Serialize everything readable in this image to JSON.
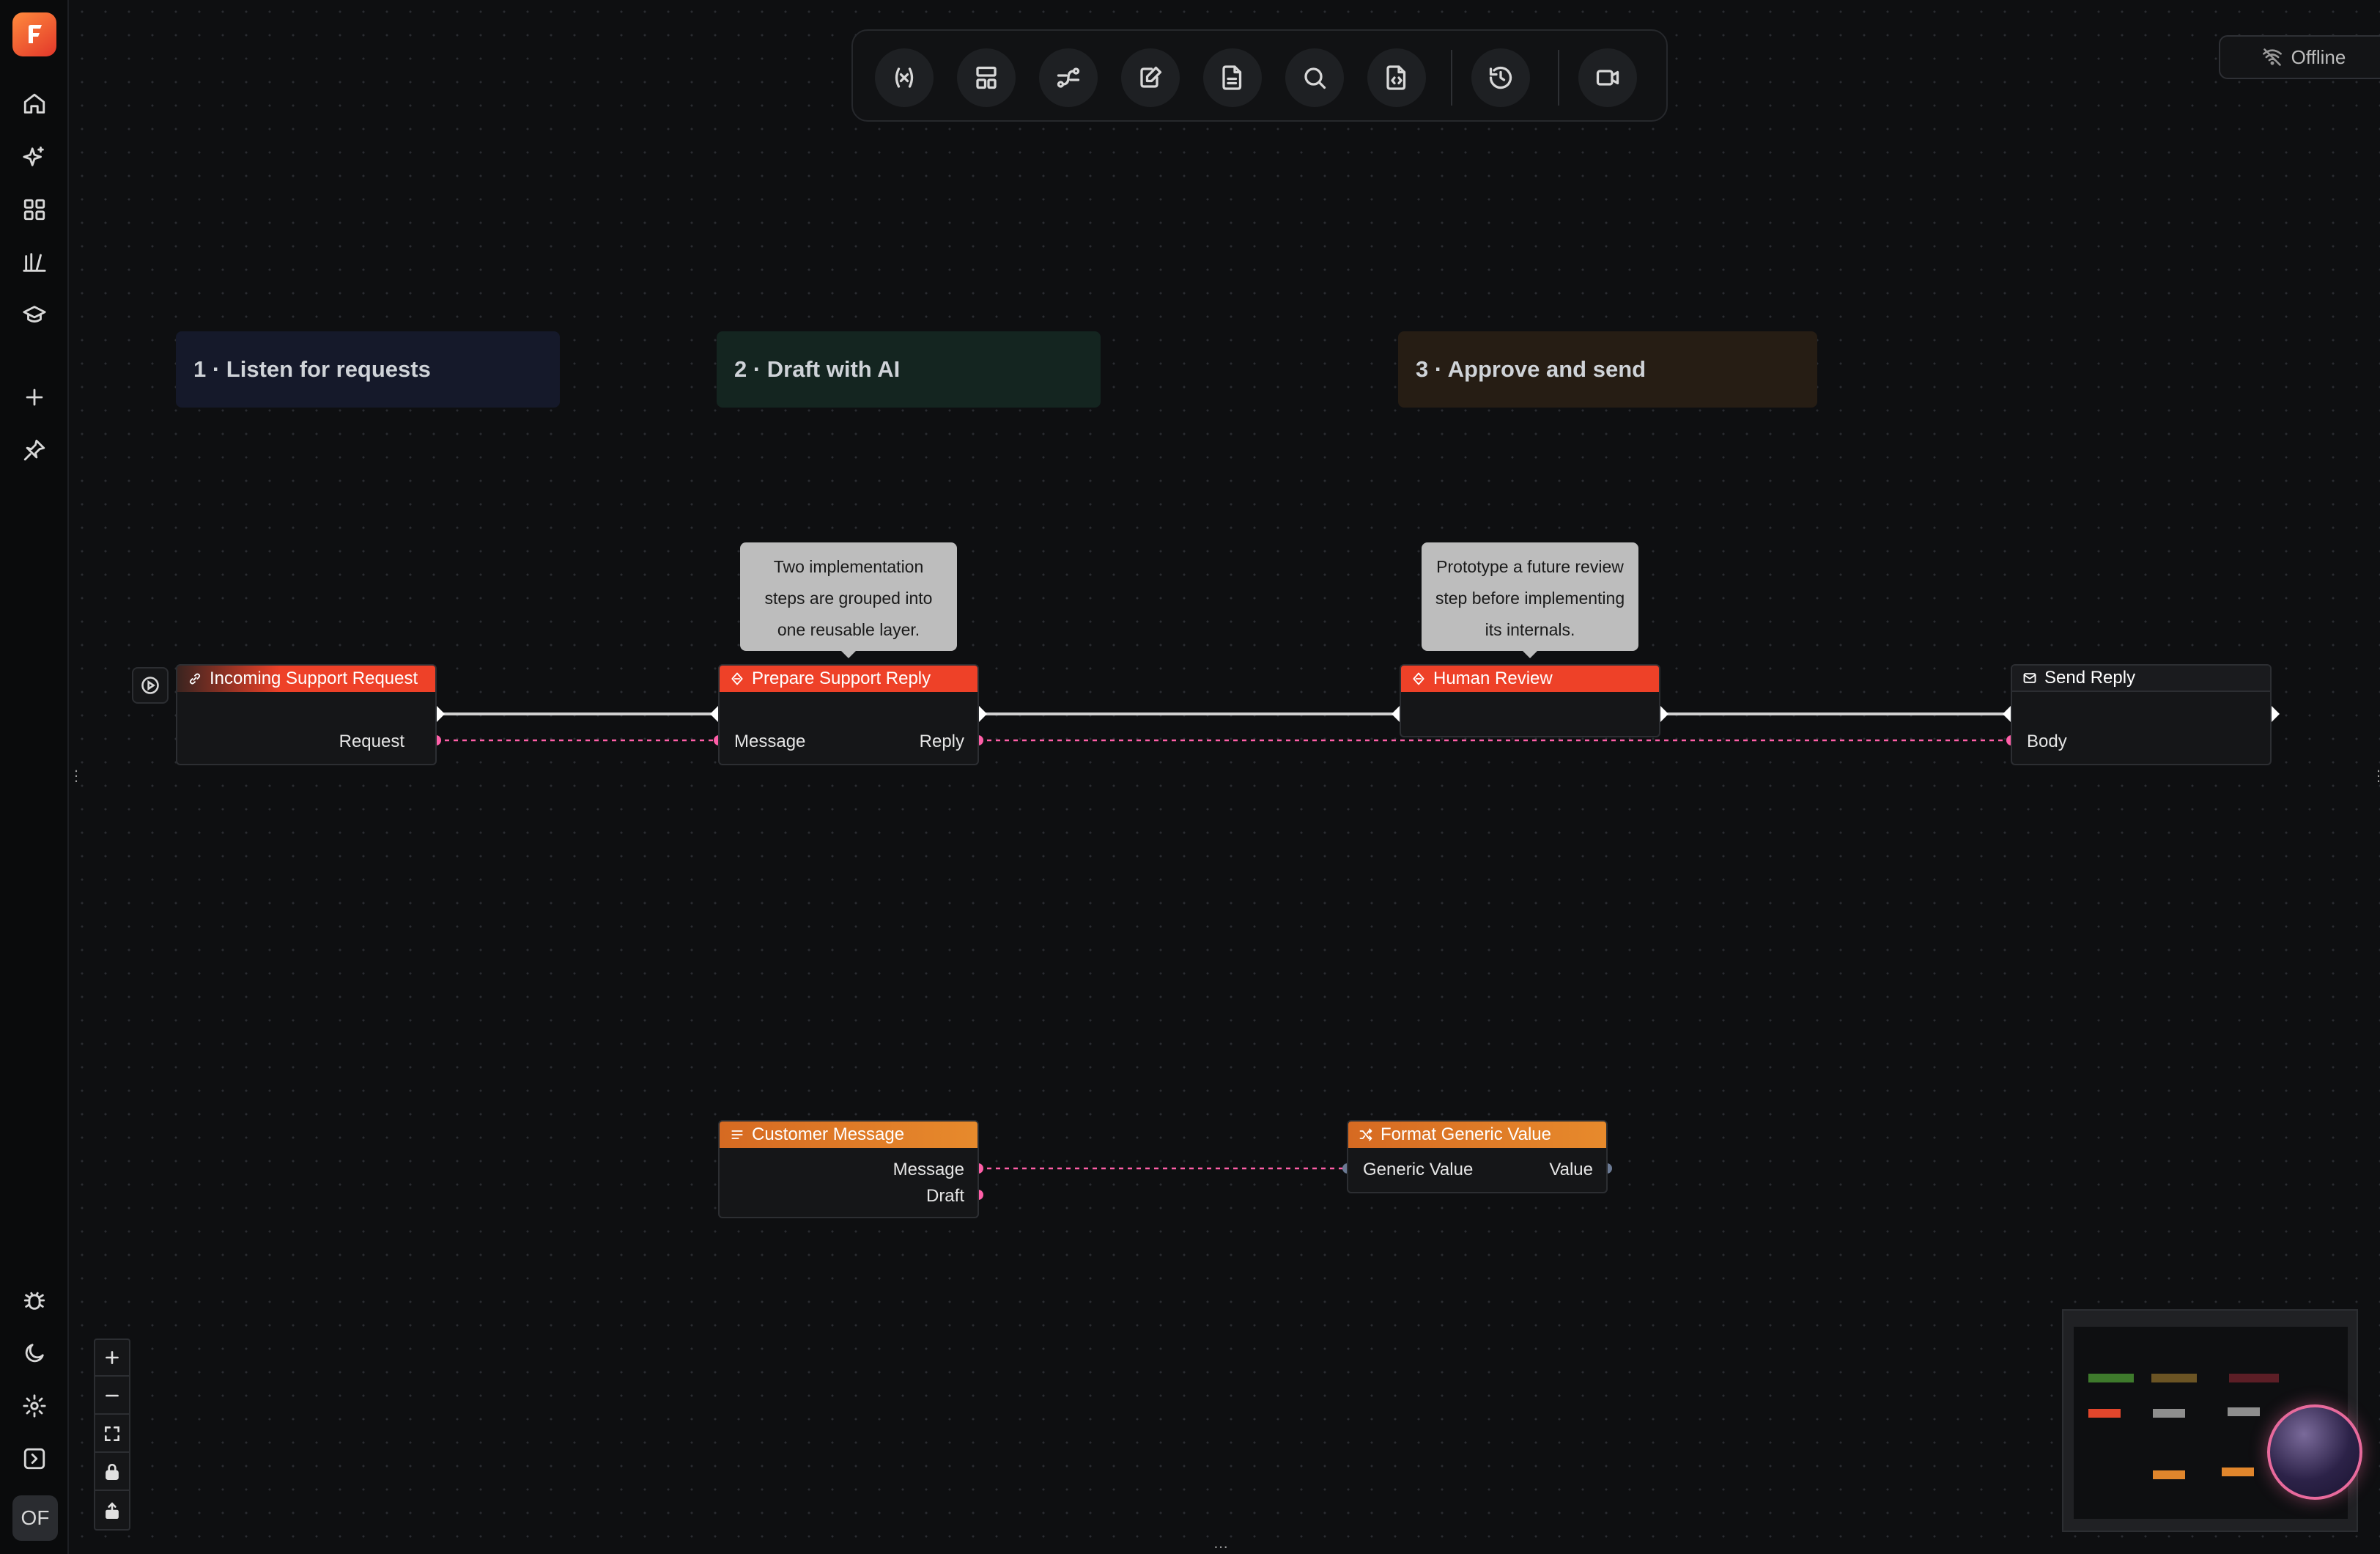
{
  "sidebar": {
    "items": [
      {
        "name": "home-icon"
      },
      {
        "name": "sparkles-icon"
      },
      {
        "name": "grid-icon"
      },
      {
        "name": "library-icon"
      },
      {
        "name": "graduation-cap-icon"
      },
      {
        "name": "plus-icon"
      },
      {
        "name": "pin-icon"
      }
    ],
    "bottom_items": [
      {
        "name": "bug-icon"
      },
      {
        "name": "moon-icon"
      },
      {
        "name": "gear-icon"
      },
      {
        "name": "panel-expand-icon"
      }
    ],
    "avatar_initials": "OF"
  },
  "toolbar": {
    "buttons": [
      "variables-icon",
      "layout-icon",
      "connections-icon",
      "edit-notes-icon",
      "document-icon",
      "search-icon",
      "code-file-icon",
      "history-icon",
      "video-icon"
    ]
  },
  "status": {
    "offline_label": "Offline"
  },
  "groups": [
    {
      "label": "1 · Listen for requests",
      "color": "#15192a"
    },
    {
      "label": "2 · Draft with AI",
      "color": "#142520"
    },
    {
      "label": "3 · Approve and send",
      "color": "#261d14"
    }
  ],
  "notes": [
    {
      "lines": [
        "Two implementation",
        "steps are grouped into",
        "one reusable layer."
      ]
    },
    {
      "lines": [
        "Prototype a future review",
        "step before implementing",
        "its internals."
      ]
    }
  ],
  "nodes": {
    "incoming": {
      "title": "Incoming Support Request",
      "out_label": "Request"
    },
    "prepare": {
      "title": "Prepare Support Reply",
      "in_label": "Message",
      "out_label": "Reply"
    },
    "review": {
      "title": "Human Review"
    },
    "send": {
      "title": "Send Reply",
      "in_label": "Body"
    },
    "customer": {
      "title": "Customer Message",
      "out_message": "Message",
      "out_draft": "Draft"
    },
    "format": {
      "title": "Format Generic Value",
      "in_label": "Generic Value",
      "out_label": "Value"
    }
  },
  "colors": {
    "accent_red": "#ee4128",
    "accent_orange": "#e0792a",
    "data_pin": "#ff5fa8",
    "generic_pin": "#6b7a94"
  }
}
